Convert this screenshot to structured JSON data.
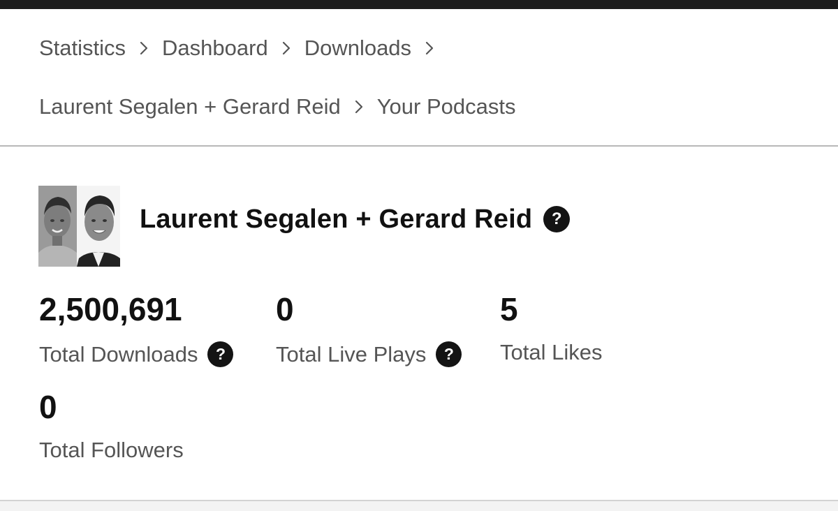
{
  "breadcrumb": {
    "items": [
      {
        "label": "Statistics"
      },
      {
        "label": "Dashboard"
      },
      {
        "label": "Downloads"
      },
      {
        "label": "Laurent Segalen + Gerard Reid"
      },
      {
        "label": "Your Podcasts"
      }
    ],
    "separator_icon": "chevron-right-icon"
  },
  "podcast": {
    "title": "Laurent Segalen + Gerard Reid",
    "avatar_icon": "podcast-hosts-avatar",
    "help_icon": "question-circle-icon"
  },
  "stats": {
    "downloads": {
      "value": "2,500,691",
      "label": "Total Downloads"
    },
    "live_plays": {
      "value": "0",
      "label": "Total Live Plays"
    },
    "likes": {
      "value": "5",
      "label": "Total Likes"
    },
    "followers": {
      "value": "0",
      "label": "Total Followers"
    }
  },
  "colors": {
    "top_bar": "#1c1c1c",
    "text_primary": "#111111",
    "text_secondary": "#555555",
    "help_icon_bg": "#141414",
    "divider": "#b8b8b8"
  }
}
